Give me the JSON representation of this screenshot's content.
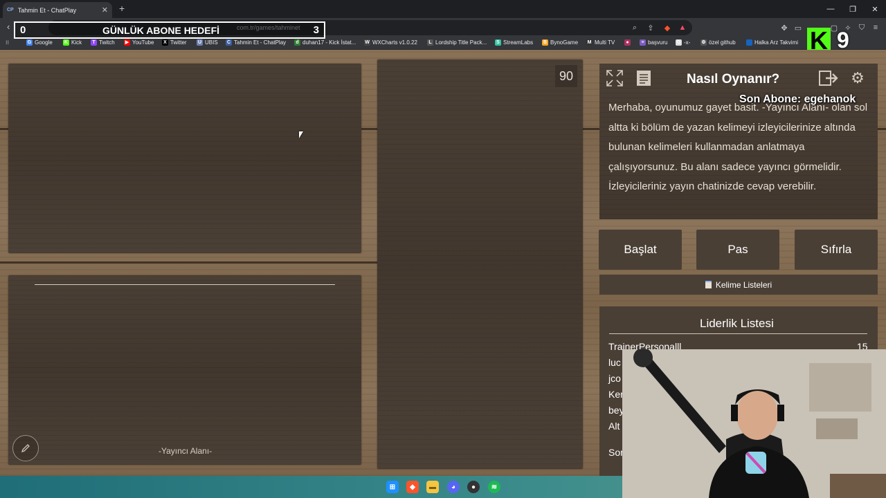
{
  "browser": {
    "tab_title": "Tahmin Et - ChatPlay",
    "tab_favicon": "CP",
    "url": "com.tr/games/tahminet",
    "bookmarks": [
      {
        "label": "Google",
        "color": "#4285f4",
        "glyph": "G"
      },
      {
        "label": "Kick",
        "color": "#53fc18",
        "glyph": "K"
      },
      {
        "label": "Twitch",
        "color": "#9146ff",
        "glyph": "T"
      },
      {
        "label": "YouTube",
        "color": "#ff0000",
        "glyph": "▶"
      },
      {
        "label": "Twitter",
        "color": "#000000",
        "glyph": "X"
      },
      {
        "label": "UBIS",
        "color": "#6b7fb0",
        "glyph": "U"
      },
      {
        "label": "Tahmin Et - ChatPlay",
        "color": "#3a5fa0",
        "glyph": "C"
      },
      {
        "label": "duhan17 - Kick İstat...",
        "color": "#2e7d32",
        "glyph": "d"
      },
      {
        "label": "WXCharts v1.0.22",
        "color": "#444444",
        "glyph": "W"
      },
      {
        "label": "Lordship Title Pack...",
        "color": "#555555",
        "glyph": "L"
      },
      {
        "label": "StreamLabs",
        "color": "#31c3a2",
        "glyph": "S"
      },
      {
        "label": "BynoGame",
        "color": "#f5a623",
        "glyph": "B"
      },
      {
        "label": "Multi TV",
        "color": "#333333",
        "glyph": "M"
      },
      {
        "label": "",
        "color": "#b03060",
        "glyph": "●"
      },
      {
        "label": "başvuru",
        "color": "#7b5cc0",
        "glyph": "≡"
      },
      {
        "label": "-x-",
        "color": "#dddddd",
        "glyph": "G"
      },
      {
        "label": "özel github",
        "color": "#555555",
        "glyph": "⚙"
      },
      {
        "label": "Halka Arz Takvimi",
        "color": "#1565c0",
        "glyph": ""
      }
    ]
  },
  "overlay": {
    "goal_current": "0",
    "goal_title": "GÜNLÜK ABONE HEDEFİ",
    "goal_target": "3",
    "kick_logo": "K",
    "kick_count": "9"
  },
  "game": {
    "timer": "90",
    "streamer_area_label": "-Yayıncı Alanı-",
    "how_to_title": "Nasıl Oynanır?",
    "last_sub": "Son Abone: egehanok",
    "how_to_text": "Merhaba, oyunumuz gayet basit. -Yayıncı Alanı- olan sol altta ki bölüm de yazan kelimeyi izleyicilerinize altında bulunan kelimeleri kullanmadan anlatmaya çalışıyorsunuz. Bu alanı sadece yayıncı görmelidir. İzleyicileriniz yayın chatinizde cevap verebilir.",
    "buttons": {
      "start": "Başlat",
      "pass": "Pas",
      "reset": "Sıfırla"
    },
    "word_lists": "Kelime Listeleri",
    "leaderboard": {
      "title": "Liderlik Listesi",
      "rows": [
        "TrainerPersonalll",
        "luc",
        "jco",
        "Ker",
        "bey",
        "Alt",
        "Sor"
      ],
      "top_score": "15"
    }
  }
}
